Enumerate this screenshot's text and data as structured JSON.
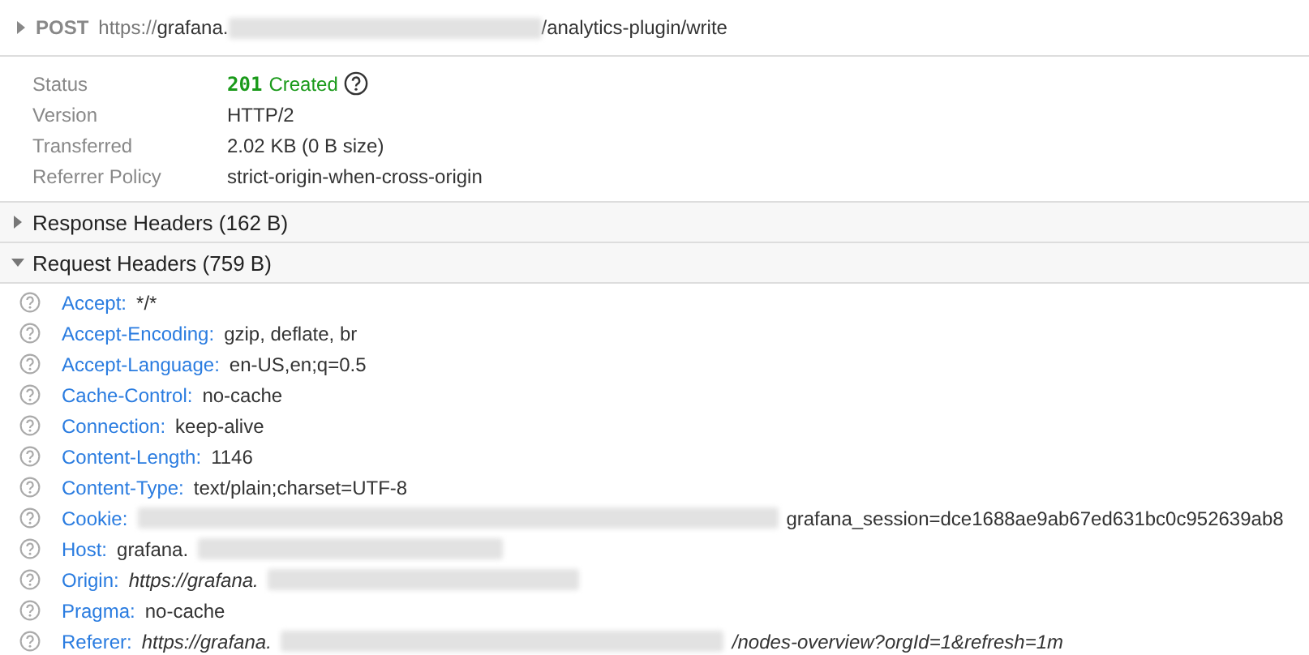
{
  "request": {
    "expanded": false,
    "method": "POST",
    "url": [
      {
        "kind": "text",
        "text": "https://"
      },
      {
        "kind": "strong",
        "text": "grafana."
      },
      {
        "kind": "redacted"
      },
      {
        "kind": "strong",
        "text": "/analytics-plugin/write"
      }
    ]
  },
  "summary": [
    {
      "label": "Status",
      "kind": "status",
      "code": "201",
      "value": "Created"
    },
    {
      "label": "Version",
      "kind": "text",
      "value": "HTTP/2"
    },
    {
      "label": "Transferred",
      "kind": "text",
      "value": "2.02 KB (0 B size)"
    },
    {
      "label": "Referrer Policy",
      "kind": "text",
      "value": "strict-origin-when-cross-origin"
    }
  ],
  "sections": [
    {
      "title": "Response Headers (162 B)",
      "expanded": false
    },
    {
      "title": "Request Headers (759 B)",
      "expanded": true,
      "headers": [
        {
          "name": "Accept:",
          "italic": false,
          "value": [
            {
              "kind": "text",
              "text": "*/*"
            }
          ]
        },
        {
          "name": "Accept-Encoding:",
          "italic": false,
          "value": [
            {
              "kind": "text",
              "text": "gzip, deflate, br"
            }
          ]
        },
        {
          "name": "Accept-Language:",
          "italic": false,
          "value": [
            {
              "kind": "text",
              "text": "en-US,en;q=0.5"
            }
          ]
        },
        {
          "name": "Cache-Control:",
          "italic": false,
          "value": [
            {
              "kind": "text",
              "text": "no-cache"
            }
          ]
        },
        {
          "name": "Connection:",
          "italic": false,
          "value": [
            {
              "kind": "text",
              "text": "keep-alive"
            }
          ]
        },
        {
          "name": "Content-Length:",
          "italic": false,
          "value": [
            {
              "kind": "text",
              "text": "1146"
            }
          ]
        },
        {
          "name": "Content-Type:",
          "italic": false,
          "value": [
            {
              "kind": "text",
              "text": "text/plain;charset=UTF-8"
            }
          ]
        },
        {
          "name": "Cookie:",
          "italic": false,
          "value": [
            {
              "kind": "redacted"
            },
            {
              "kind": "text",
              "text": "grafana_session=dce1688ae9ab67ed631bc0c952639ab8"
            }
          ]
        },
        {
          "name": "Host:",
          "italic": false,
          "value": [
            {
              "kind": "text",
              "text": "grafana."
            },
            {
              "kind": "redacted"
            }
          ]
        },
        {
          "name": "Origin:",
          "italic": true,
          "value": [
            {
              "kind": "text",
              "text": "https://grafana."
            },
            {
              "kind": "redacted"
            }
          ]
        },
        {
          "name": "Pragma:",
          "italic": false,
          "value": [
            {
              "kind": "text",
              "text": "no-cache"
            }
          ]
        },
        {
          "name": "Referer:",
          "italic": true,
          "value": [
            {
              "kind": "text",
              "text": "https://grafana."
            },
            {
              "kind": "redacted"
            },
            {
              "kind": "text",
              "text": "/nodes-overview?orgId=1&refresh=1m"
            }
          ]
        }
      ]
    }
  ]
}
